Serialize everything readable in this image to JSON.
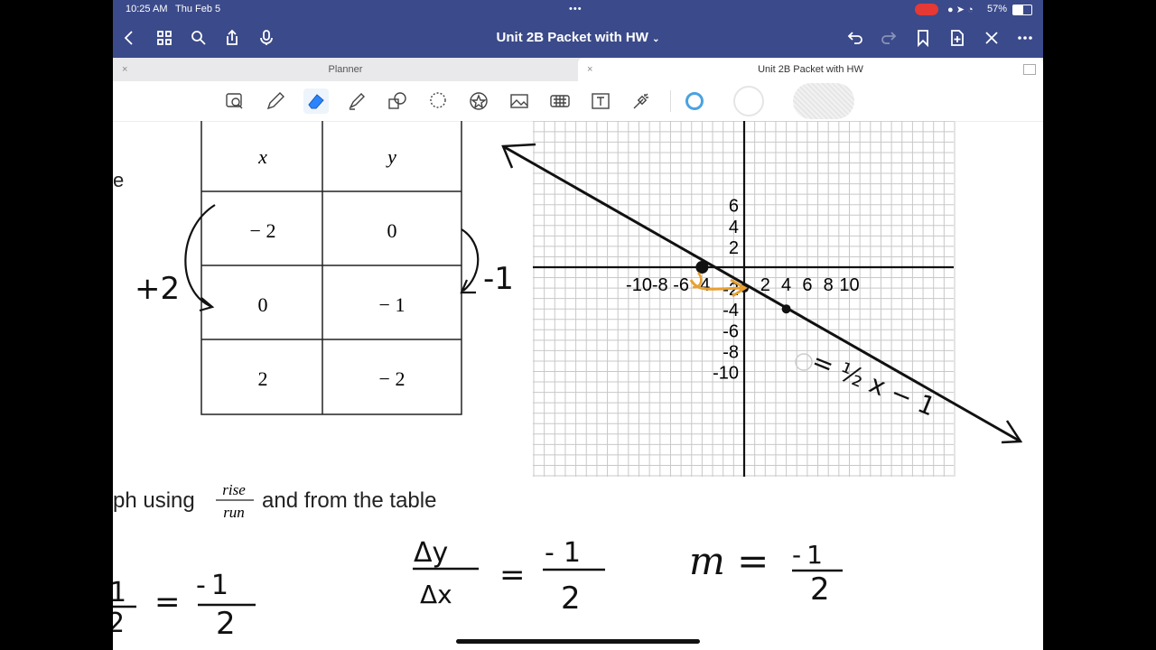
{
  "status": {
    "time": "10:25 AM",
    "date": "Thu Feb 5",
    "battery": "57%"
  },
  "header": {
    "doc_title": "Unit 2B Packet with HW"
  },
  "tabs": [
    {
      "label": "Planner"
    },
    {
      "label": "Unit 2B Packet with HW"
    }
  ],
  "tab_close_glyph": "×",
  "toolbar": {
    "icons": [
      "lasso-zoom-icon",
      "pen-icon",
      "eraser-icon",
      "highlighter-icon",
      "shapes-icon",
      "lasso-icon",
      "sticker-icon",
      "image-icon",
      "keyboard-icon",
      "text-icon",
      "laser-pointer-icon"
    ],
    "colors": [
      "#4aa3df",
      "#ffffff",
      "#e0e0e0"
    ]
  },
  "table": {
    "headers": [
      "x",
      "y"
    ],
    "rows": [
      [
        "− 2",
        "0"
      ],
      [
        "0",
        "− 1"
      ],
      [
        "2",
        "− 2"
      ]
    ]
  },
  "graph": {
    "x_ticks": [
      "-10",
      "-8",
      "-6",
      "-4",
      "2",
      "4",
      "6",
      "8",
      "10"
    ],
    "y_ticks": [
      "6",
      "4",
      "2",
      "-2",
      "-4",
      "-6",
      "-8",
      "-10"
    ],
    "points": [
      [
        -2,
        0
      ],
      [
        0,
        -1
      ],
      [
        2,
        -2
      ]
    ]
  },
  "page_text": {
    "left_fragment": "e",
    "instruction_before": "ph using",
    "frac_num": "rise",
    "frac_den": "run",
    "instruction_after": "and from the table"
  },
  "handwriting": {
    "plus_two": "+2",
    "minus_one": "-1",
    "equation": "= ½ x − 1",
    "delta_y": "Δy",
    "delta_x": "Δx",
    "equals": "=",
    "m": "m",
    "eq_neg": "-",
    "one": "1",
    "two": "2",
    "m_equals": "m ="
  }
}
